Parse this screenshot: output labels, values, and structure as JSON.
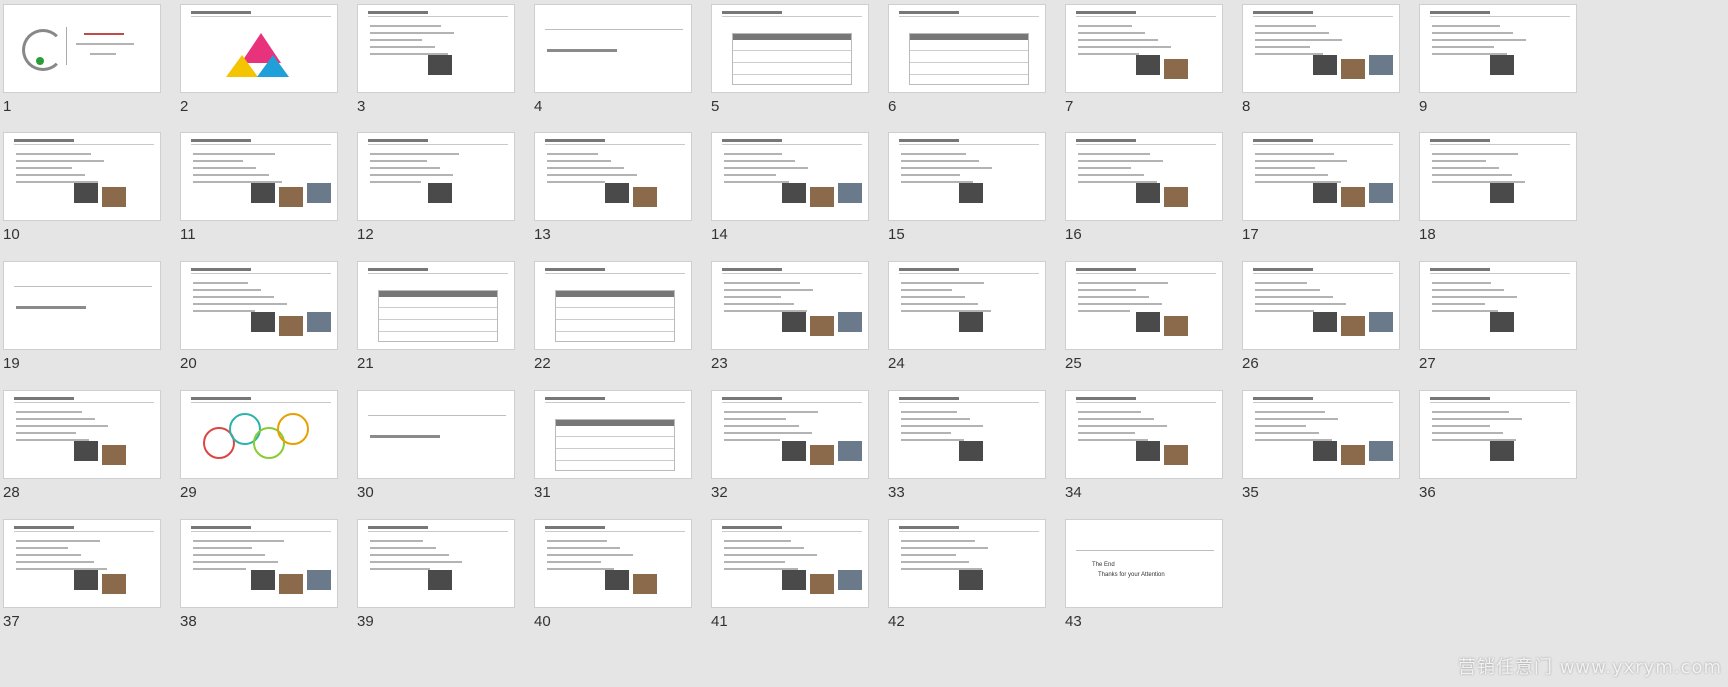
{
  "app": {
    "watermark": "营销任意门 www.yxrym.com"
  },
  "slides": [
    {
      "num": "1"
    },
    {
      "num": "2"
    },
    {
      "num": "3"
    },
    {
      "num": "4"
    },
    {
      "num": "5"
    },
    {
      "num": "6"
    },
    {
      "num": "7"
    },
    {
      "num": "8"
    },
    {
      "num": "9"
    },
    {
      "num": "10"
    },
    {
      "num": "11"
    },
    {
      "num": "12"
    },
    {
      "num": "13"
    },
    {
      "num": "14"
    },
    {
      "num": "15"
    },
    {
      "num": "16"
    },
    {
      "num": "17"
    },
    {
      "num": "18"
    },
    {
      "num": "19"
    },
    {
      "num": "20"
    },
    {
      "num": "21"
    },
    {
      "num": "22"
    },
    {
      "num": "23"
    },
    {
      "num": "24"
    },
    {
      "num": "25"
    },
    {
      "num": "26"
    },
    {
      "num": "27"
    },
    {
      "num": "28"
    },
    {
      "num": "29"
    },
    {
      "num": "30"
    },
    {
      "num": "31"
    },
    {
      "num": "32"
    },
    {
      "num": "33"
    },
    {
      "num": "34"
    },
    {
      "num": "35"
    },
    {
      "num": "36"
    },
    {
      "num": "37"
    },
    {
      "num": "38"
    },
    {
      "num": "39"
    },
    {
      "num": "40"
    },
    {
      "num": "41"
    },
    {
      "num": "42"
    },
    {
      "num": "43"
    }
  ],
  "slide43": {
    "bullet1": "The End",
    "bullet2": "Thanks for your Attention"
  },
  "colors": {
    "accent_pink": "#e8327c",
    "accent_yellow": "#f4c400",
    "accent_blue": "#1fa0d8",
    "accent_teal": "#2bb3a9"
  }
}
